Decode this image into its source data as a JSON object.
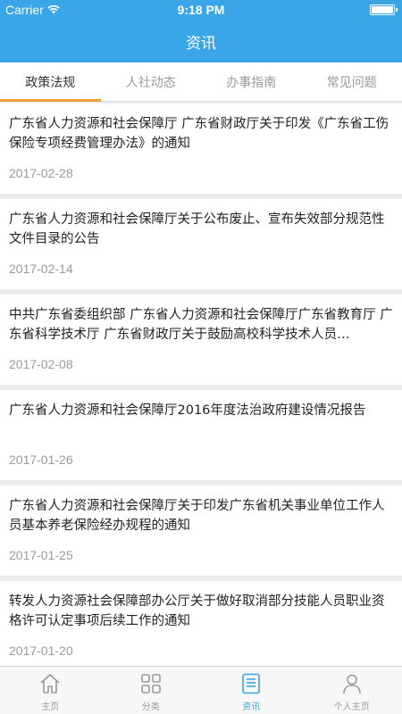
{
  "status": {
    "carrier": "Carrier",
    "time": "9:18 PM"
  },
  "header": {
    "title": "资讯"
  },
  "tabs": [
    {
      "label": "政策法规",
      "active": true
    },
    {
      "label": "人社动态",
      "active": false
    },
    {
      "label": "办事指南",
      "active": false
    },
    {
      "label": "常见问题",
      "active": false
    }
  ],
  "articles": [
    {
      "title": "广东省人力资源和社会保障厅  广东省财政厅关于印发《广东省工伤保险专项经费管理办法》的通知",
      "date": "2017-02-28"
    },
    {
      "title": "广东省人力资源和社会保障厅关于公布废止、宣布失效部分规范性文件目录的公告",
      "date": "2017-02-14"
    },
    {
      "title": "中共广东省委组织部 广东省人力资源和社会保障厅广东省教育厅 广东省科学技术厅 广东省财政厅关于鼓励高校科学技术人员…",
      "date": "2017-02-08"
    },
    {
      "title": "广东省人力资源和社会保障厅2016年度法治政府建设情况报告",
      "date": "2017-01-26"
    },
    {
      "title": "广东省人力资源和社会保障厅关于印发广东省机关事业单位工作人员基本养老保险经办规程的通知",
      "date": "2017-01-25"
    },
    {
      "title": "转发人力资源社会保障部办公厅关于做好取消部分技能人员职业资格许可认定事项后续工作的通知",
      "date": "2017-01-20"
    }
  ],
  "tabbar": [
    {
      "label": "主页",
      "icon": "home-icon",
      "active": false
    },
    {
      "label": "分类",
      "icon": "grid-icon",
      "active": false
    },
    {
      "label": "资讯",
      "icon": "news-icon",
      "active": true
    },
    {
      "label": "个人主页",
      "icon": "person-icon",
      "active": false
    }
  ],
  "colors": {
    "accent": "#3aa6e7",
    "tab_indicator": "#f29a38"
  }
}
